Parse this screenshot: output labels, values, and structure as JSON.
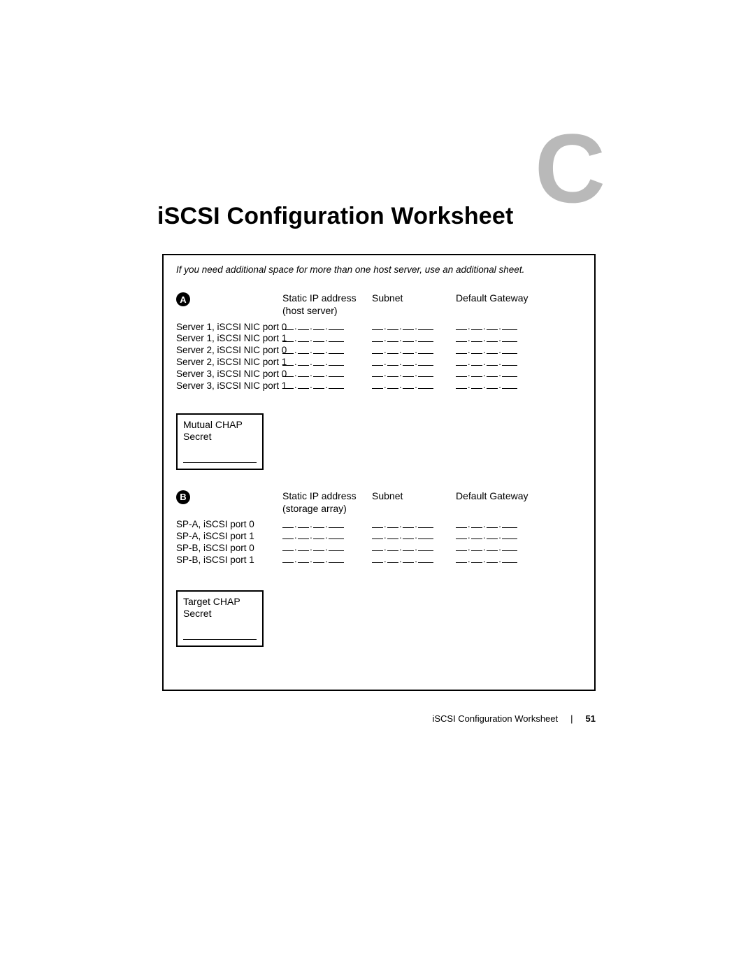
{
  "appendix_letter": "C",
  "title": "iSCSI Configuration Worksheet",
  "note": "If you need additional space for more than one host server, use an additional sheet.",
  "section_a": {
    "badge": "A",
    "headers": {
      "ip": "Static IP address (host server)",
      "subnet": "Subnet",
      "gateway": "Default Gateway"
    },
    "rows": [
      "Server 1, iSCSI NIC port 0",
      "Server 1, iSCSI NIC port 1",
      "Server 2, iSCSI NIC port 0",
      "Server 2, iSCSI NIC port 1",
      "Server 3, iSCSI NIC port 0",
      "Server 3, iSCSI NIC port 1"
    ],
    "chap_label": "Mutual CHAP Secret"
  },
  "section_b": {
    "badge": "B",
    "headers": {
      "ip": "Static IP address (storage array)",
      "subnet": "Subnet",
      "gateway": "Default Gateway"
    },
    "rows": [
      "SP-A, iSCSI port 0",
      "SP-A, iSCSI port 1",
      "SP-B, iSCSI port 0",
      "SP-B, iSCSI port 1"
    ],
    "chap_label": "Target CHAP Secret"
  },
  "footer": {
    "section": "iSCSI Configuration Worksheet",
    "separator": "|",
    "page": "51"
  }
}
